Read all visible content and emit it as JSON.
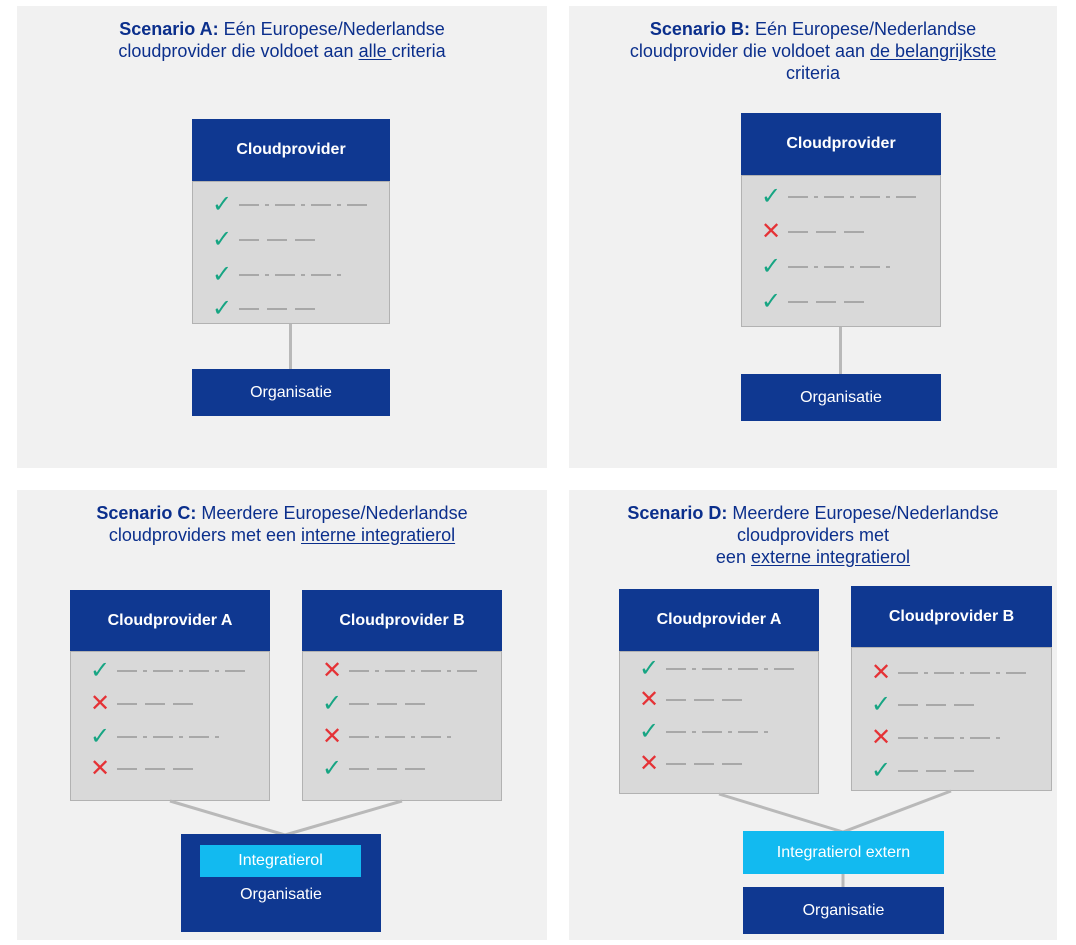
{
  "colors": {
    "navy": "#0f3891",
    "cyan": "#12baf0",
    "check": "#17a583",
    "cross": "#e53236",
    "panel": "#f1f1f1"
  },
  "A": {
    "label": "Scenario A:",
    "text_before": " Eén Europese/Nederlandse cloudprovider die voldoet aan ",
    "underlined": "alle ",
    "text_after": "criteria",
    "provider": "Cloudprovider",
    "org": "Organisatie",
    "marks": [
      "check",
      "check",
      "check",
      "check"
    ]
  },
  "B": {
    "label": "Scenario B:",
    "text_before": " Eén Europese/Nederlandse cloudprovider die voldoet aan ",
    "underlined": "de belangrijkste",
    "text_after": " criteria",
    "provider": "Cloudprovider",
    "org": "Organisatie",
    "marks": [
      "check",
      "cross",
      "check",
      "check"
    ]
  },
  "C": {
    "label": "Scenario C:",
    "text_before": " Meerdere Europese/Nederlandse cloudproviders met een ",
    "underlined": "interne integratierol",
    "text_after": "",
    "provider_a": "Cloudprovider A",
    "provider_b": "Cloudprovider B",
    "integration": "Integratierol",
    "org": "Organisatie",
    "marks_a": [
      "check",
      "cross",
      "check",
      "cross"
    ],
    "marks_b": [
      "cross",
      "check",
      "cross",
      "check"
    ]
  },
  "D": {
    "label": "Scenario D:",
    "text_before": " Meerdere Europese/Nederlandse cloudproviders met",
    "text_line3": "een ",
    "underlined": "externe integratierol",
    "text_after": "",
    "provider_a": "Cloudprovider A",
    "provider_b": "Cloudprovider B",
    "integration": "Integratierol extern",
    "org": "Organisatie",
    "marks_a": [
      "check",
      "cross",
      "check",
      "cross"
    ],
    "marks_b": [
      "cross",
      "check",
      "cross",
      "check"
    ]
  }
}
